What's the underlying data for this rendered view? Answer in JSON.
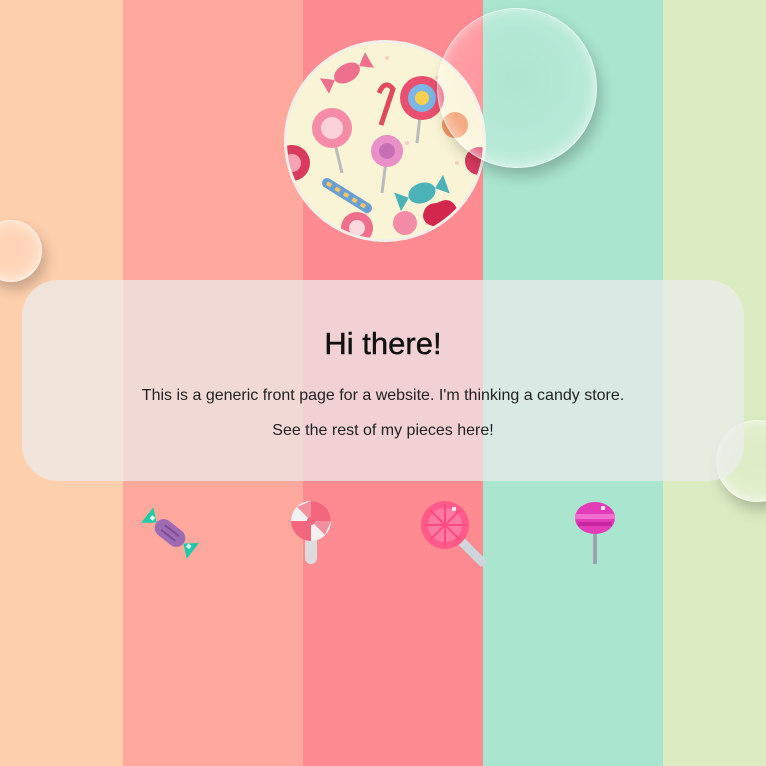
{
  "colors": {
    "stripes": [
      "#ffd0ae",
      "#ffa99e",
      "#ff8b92",
      "#a9e5cf",
      "#dbecc2"
    ],
    "accent": "#ff6b8a"
  },
  "hero": {
    "title": "Hi there!",
    "description": "This is a generic front page for a website. I'm thinking a candy store.",
    "link_text": "See the rest of my pieces here!"
  },
  "icons": [
    "wrapped-candy-icon",
    "swirl-lollipop-icon",
    "pink-lollipop-icon",
    "magenta-lollipop-icon"
  ]
}
